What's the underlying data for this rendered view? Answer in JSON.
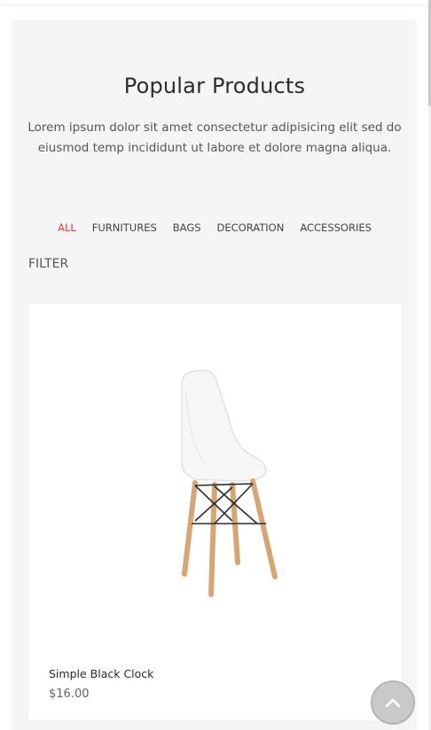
{
  "section": {
    "title": "Popular Products",
    "description": "Lorem ipsum dolor sit amet consectetur adipisicing elit sed do eiusmod temp incididunt ut labore et dolore magna aliqua."
  },
  "filters": {
    "items": [
      "ALL",
      "FURNITURES",
      "BAGS",
      "DECORATION",
      "ACCESSORIES"
    ],
    "active_color": "#e03a3a",
    "label": "FILTER"
  },
  "product": {
    "name": "Simple Black Clock",
    "price": "$16.00"
  },
  "icons": {
    "back_to_top": "chevron-up-icon",
    "product_image": "chair-image"
  }
}
